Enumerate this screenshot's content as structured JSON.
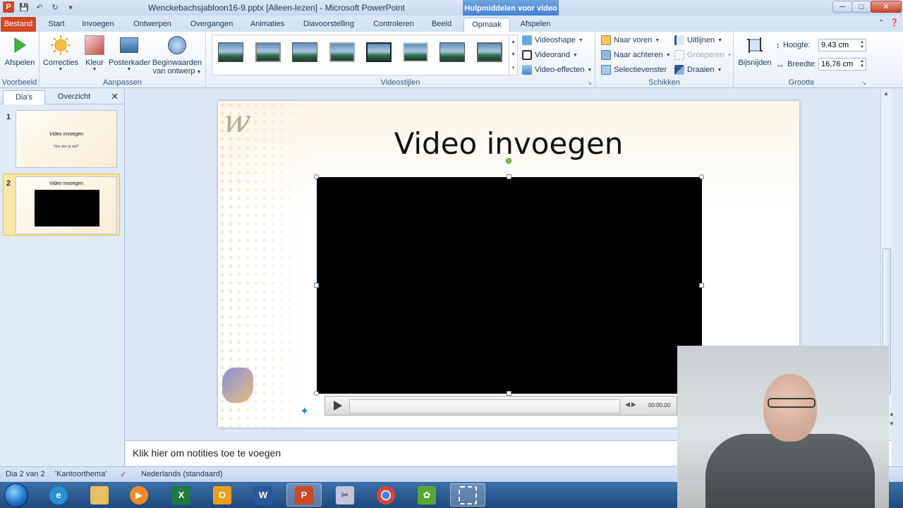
{
  "window": {
    "title": "Wenckebachsjabloon16-9.pptx [Alleen-lezen] - Microsoft PowerPoint",
    "context_tab_group": "Hulpmiddelen voor video",
    "app_logo": "P"
  },
  "tabs": [
    {
      "label": "Bestand"
    },
    {
      "label": "Start"
    },
    {
      "label": "Invoegen"
    },
    {
      "label": "Ontwerpen"
    },
    {
      "label": "Overgangen"
    },
    {
      "label": "Animaties"
    },
    {
      "label": "Diavoorstelling"
    },
    {
      "label": "Controleren"
    },
    {
      "label": "Beeld"
    },
    {
      "label": "Opmaak"
    },
    {
      "label": "Afspelen"
    }
  ],
  "ribbon": {
    "voorbeeld": {
      "label": "Voorbeeld",
      "afspelen": "Afspelen"
    },
    "aanpassen": {
      "label": "Aanpassen",
      "correcties": "Correcties",
      "kleur": "Kleur",
      "posterkader": "Posterkader",
      "beginwaarden_line1": "Beginwaarden",
      "beginwaarden_line2": "van ontwerp"
    },
    "videostijlen": {
      "label": "Videostijlen",
      "videoshape": "Videoshape",
      "videorand": "Videorand",
      "video_effecten": "Video-effecten"
    },
    "schikken": {
      "label": "Schikken",
      "naar_voren": "Naar voren",
      "naar_achteren": "Naar achteren",
      "selectievenster": "Selectievenster",
      "uitlijnen": "Uitlijnen",
      "groeperen": "Groeperen",
      "draaien": "Draaien"
    },
    "grootte": {
      "label": "Grootte",
      "bijsnijden": "Bijsnijden",
      "hoogte_label": "Hoogte:",
      "hoogte_value": "9,43 cm",
      "breedte_label": "Breedte:",
      "breedte_value": "16,76 cm"
    }
  },
  "left_panel": {
    "tab_slides": "Dia's",
    "tab_outline": "Overzicht",
    "close": "✕",
    "slides": [
      {
        "number": "1",
        "title": "Video invoegen",
        "subtitle": "Hoe doe je dat?"
      },
      {
        "number": "2",
        "title": "Video invoegen"
      }
    ]
  },
  "slide": {
    "title": "Video invoegen",
    "player_time": "00:00.00"
  },
  "notes": {
    "placeholder": "Klik hier om notities toe te voegen"
  },
  "status": {
    "slide_counter": "Dia 2 van 2",
    "theme": "'Kantoorthema'",
    "language": "Nederlands (standaard)"
  },
  "colors": {
    "file_tab": "#d24726",
    "context_tab": "#3f7fd1",
    "accent": "#2b579a"
  },
  "taskbar": {
    "apps": [
      "start-orb",
      "ie-icon",
      "explorer-icon",
      "media-player-icon",
      "excel-icon",
      "outlook-icon",
      "word-icon",
      "powerpoint-icon",
      "snipping-icon",
      "chrome-icon",
      "evernote-icon",
      "screen-capture-icon"
    ]
  }
}
